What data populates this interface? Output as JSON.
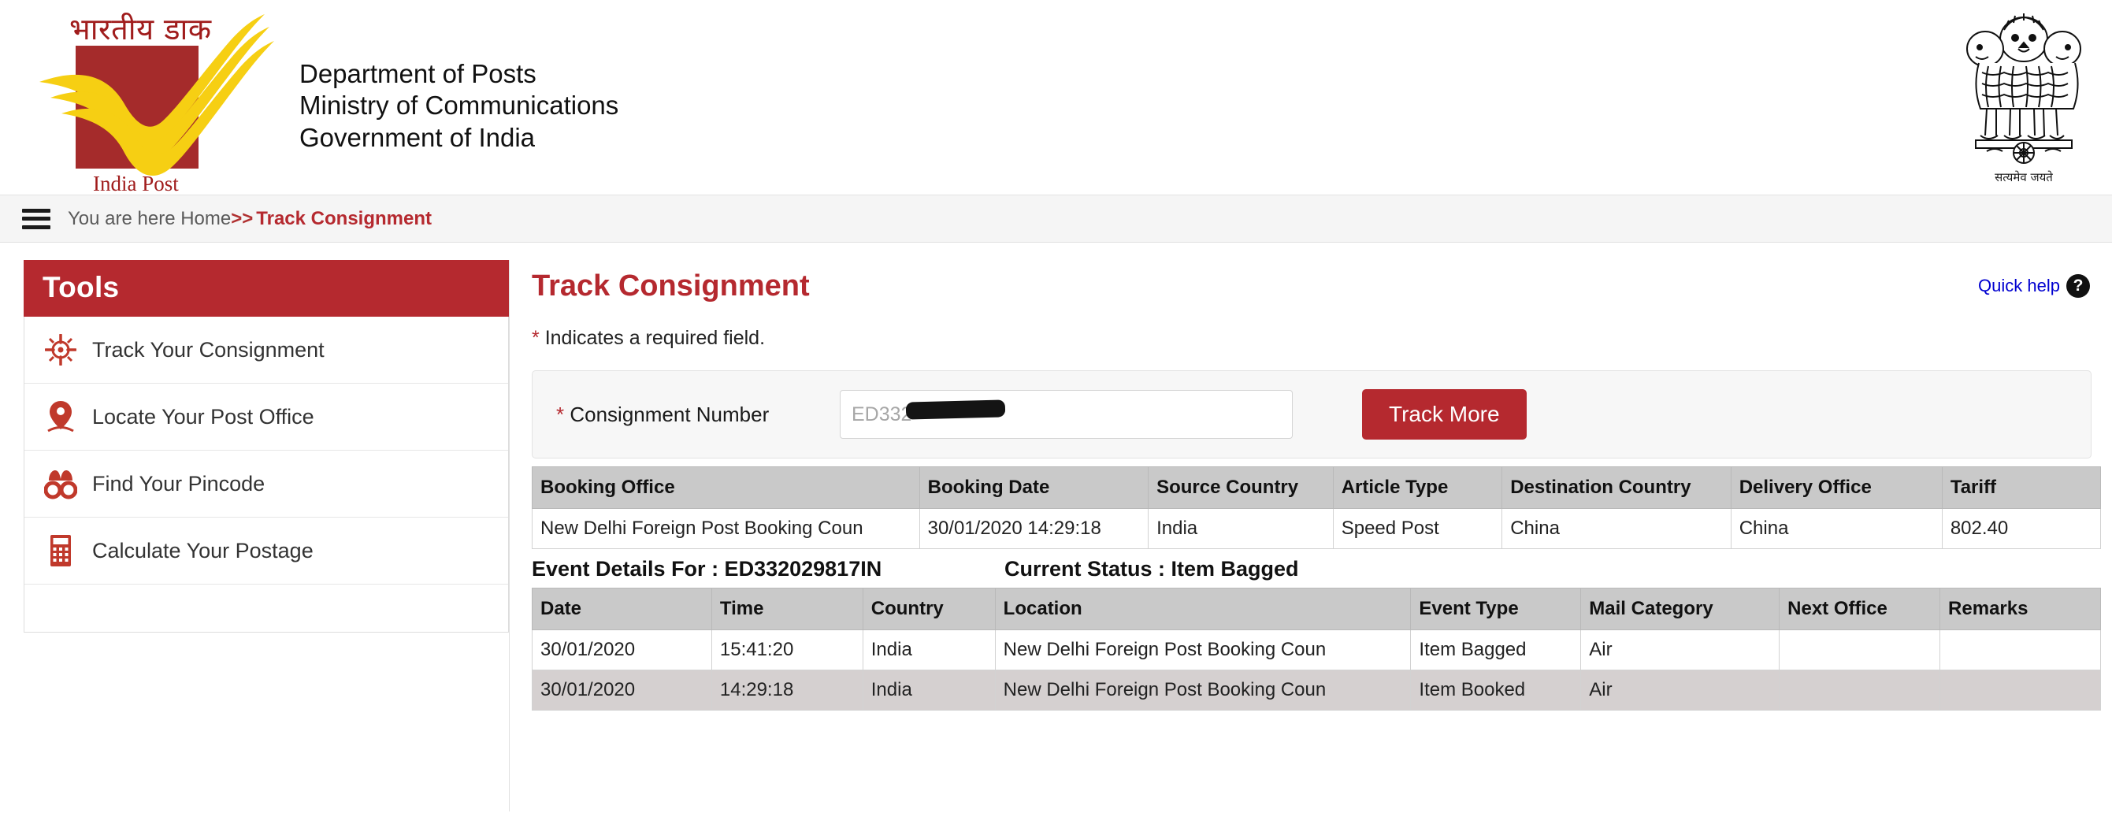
{
  "header": {
    "logo_hindi": "भारतीय डाक",
    "logo_caption": "India Post",
    "department_lines": [
      "Department of Posts",
      "Ministry of Communications",
      "Government of India"
    ],
    "emblem_name": "ashoka-lion-capital",
    "emblem_caption": "सत्यमेव जयते",
    "brand_color": "#a52b2b",
    "accent_color": "#b5292f"
  },
  "breadcrumb": {
    "menu_icon": "hamburger-icon",
    "prefix": "You are here Home",
    "separator": ">>",
    "current": "Track Consignment"
  },
  "sidebar": {
    "title": "Tools",
    "items": [
      {
        "label": "Track Your Consignment",
        "icon": "crosshair-target-icon"
      },
      {
        "label": "Locate Your Post Office",
        "icon": "map-pin-icon"
      },
      {
        "label": "Find Your Pincode",
        "icon": "binoculars-icon"
      },
      {
        "label": "Calculate Your Postage",
        "icon": "calculator-icon"
      }
    ]
  },
  "main": {
    "title": "Track Consignment",
    "required_star": "*",
    "required_note": "Indicates a required field.",
    "quick_help": {
      "label": "Quick help",
      "icon": "question-mark-circle-icon",
      "link_color": "#0000d0"
    },
    "form": {
      "label_star": "*",
      "label": "Consignment Number",
      "input_value": "ED332",
      "input_placeholder": "",
      "redacted": true,
      "submit_label": "Track More"
    },
    "booking_table": {
      "columns": [
        "Booking Office",
        "Booking Date",
        "Source Country",
        "Article Type",
        "Destination Country",
        "Delivery Office",
        "Tariff"
      ],
      "rows": [
        [
          "New Delhi Foreign Post Booking Coun",
          "30/01/2020 14:29:18",
          "India",
          "Speed Post",
          "China",
          "China",
          "802.40"
        ]
      ]
    },
    "event_section": {
      "title": "Event Details For : ED332029817IN",
      "status": "Current Status : Item Bagged",
      "columns": [
        "Date",
        "Time",
        "Country",
        "Location",
        "Event Type",
        "Mail Category",
        "Next Office",
        "Remarks"
      ],
      "rows": [
        [
          "30/01/2020",
          "15:41:20",
          "India",
          "New Delhi Foreign Post Booking Coun",
          "Item Bagged",
          "Air",
          "",
          ""
        ],
        [
          "30/01/2020",
          "14:29:18",
          "India",
          "New Delhi Foreign Post Booking Coun",
          "Item Booked",
          "Air",
          "",
          ""
        ]
      ]
    }
  }
}
